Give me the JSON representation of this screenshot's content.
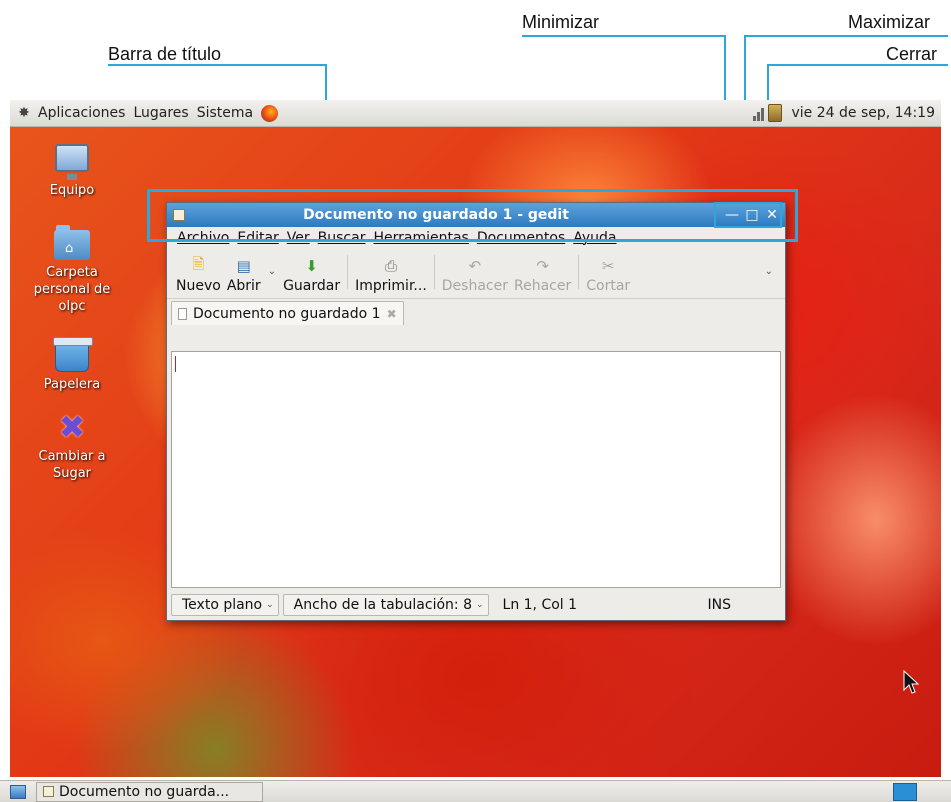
{
  "annotations": {
    "minimizar": "Minimizar",
    "maximizar": "Maximizar",
    "cerrar": "Cerrar",
    "barra_titulo": "Barra de título"
  },
  "top_panel": {
    "menus": [
      "Aplicaciones",
      "Lugares",
      "Sistema"
    ],
    "clock": "vie 24 de sep, 14:19"
  },
  "desktop_icons": [
    {
      "label": "Equipo",
      "icon": "computer-icon"
    },
    {
      "label": "Carpeta personal de olpc",
      "icon": "home-folder-icon"
    },
    {
      "label": "Papelera",
      "icon": "trash-icon"
    },
    {
      "label": "Cambiar a Sugar",
      "icon": "sugar-icon"
    }
  ],
  "window": {
    "title": "Documento no guardado 1 - gedit",
    "menus": [
      "Archivo",
      "Editar",
      "Ver",
      "Buscar",
      "Herramientas",
      "Documentos",
      "Ayuda"
    ],
    "toolbar": {
      "nuevo": "Nuevo",
      "abrir": "Abrir",
      "guardar": "Guardar",
      "imprimir": "Imprimir...",
      "deshacer": "Deshacer",
      "rehacer": "Rehacer",
      "cortar": "Cortar"
    },
    "tab_label": "Documento no guardado 1",
    "status": {
      "language": "Texto plano",
      "tab_width": "Ancho de la tabulación: 8",
      "position": "Ln 1, Col 1",
      "mode": "INS"
    }
  },
  "bottom_panel": {
    "task_label": "Documento no guarda..."
  },
  "colors": {
    "annotation": "#2ea6d9",
    "titlebar": "#3f8ccf"
  }
}
